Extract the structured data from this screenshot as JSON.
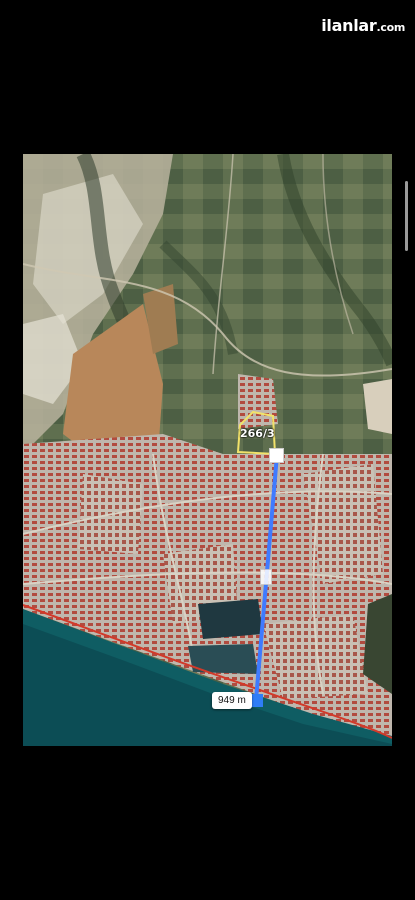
{
  "watermark": {
    "brand": "ilanlar",
    "tld": ".com"
  },
  "map": {
    "parcel_label": "266/3",
    "distance_label": "949 m",
    "measure_line_color": "#3f7bff",
    "parcel_outline_color": "#f2e26a",
    "coastline_color": "#d23a2a",
    "sea_color": "#0f5d63"
  },
  "icons": {
    "start": "square-handle-icon",
    "mid": "midpoint-handle-icon",
    "end": "endpoint-handle-icon"
  }
}
